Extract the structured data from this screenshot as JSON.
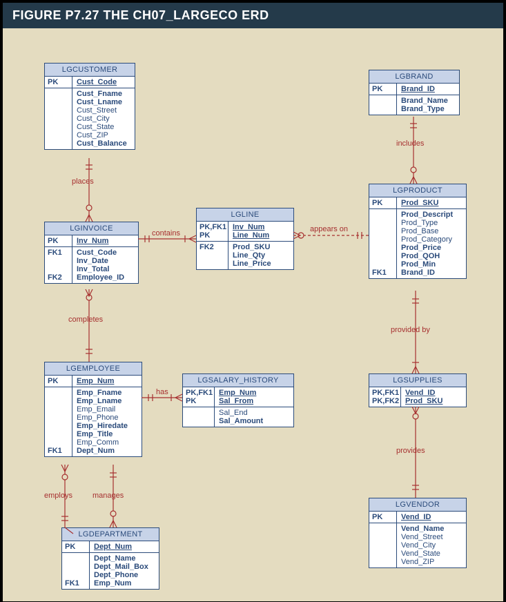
{
  "figure_title": "FIGURE P7.27  THE CH07_LARGECO ERD",
  "entities": {
    "lgcustomer": {
      "name": "LGCUSTOMER",
      "pk_key": "PK",
      "pk_attr": "Cust_Code",
      "attrs": [
        "Cust_Fname",
        "Cust_Lname",
        "Cust_Street",
        "Cust_City",
        "Cust_State",
        "Cust_ZIP",
        "Cust_Balance"
      ],
      "bold_idx": [
        0,
        1,
        6
      ]
    },
    "lginvoice": {
      "name": "LGINVOICE",
      "pk_key": "PK",
      "pk_attr": "Inv_Num",
      "rows": [
        {
          "key": "FK1",
          "attrs": [
            "Cust_Code",
            "Inv_Date",
            "Inv_Total"
          ],
          "bold": [
            0,
            1,
            2
          ]
        },
        {
          "key": "FK2",
          "attrs": [
            "Employee_ID"
          ],
          "bold": [
            0
          ]
        }
      ]
    },
    "lgline": {
      "name": "LGLINE",
      "pk_keys": [
        "PK,FK1",
        "PK"
      ],
      "pk_attrs": [
        "Inv_Num",
        "Line_Num"
      ],
      "rows": [
        {
          "key": "FK2",
          "attrs": [
            "Prod_SKU",
            "Line_Qty",
            "Line_Price"
          ],
          "bold": [
            0,
            1,
            2
          ]
        }
      ]
    },
    "lgbrand": {
      "name": "LGBRAND",
      "pk_key": "PK",
      "pk_attr": "Brand_ID",
      "attrs": [
        "Brand_Name",
        "Brand_Type"
      ],
      "bold_idx": [
        0,
        1
      ]
    },
    "lgproduct": {
      "name": "LGPRODUCT",
      "pk_key": "PK",
      "pk_attr": "Prod_SKU",
      "rows": [
        {
          "key": "",
          "attrs": [
            "Prod_Descript",
            "Prod_Type",
            "Prod_Base",
            "Prod_Category",
            "Prod_Price",
            "Prod_QOH",
            "Prod_Min"
          ],
          "bold": [
            0,
            4,
            5,
            6
          ]
        },
        {
          "key": "FK1",
          "attrs": [
            "Brand_ID"
          ],
          "bold": [
            0
          ]
        }
      ]
    },
    "lgemployee": {
      "name": "LGEMPLOYEE",
      "pk_key": "PK",
      "pk_attr": "Emp_Num",
      "rows": [
        {
          "key": "",
          "attrs": [
            "Emp_Fname",
            "Emp_Lname",
            "Emp_Email",
            "Emp_Phone",
            "Emp_Hiredate",
            "Emp_Title",
            "Emp_Comm"
          ],
          "bold": [
            0,
            1,
            4,
            5
          ]
        },
        {
          "key": "FK1",
          "attrs": [
            "Dept_Num"
          ],
          "bold": [
            0
          ]
        }
      ]
    },
    "lgsalary": {
      "name": "LGSALARY_HISTORY",
      "pk_keys": [
        "PK,FK1",
        "PK"
      ],
      "pk_attrs": [
        "Emp_Num",
        "Sal_From"
      ],
      "attrs": [
        "Sal_End",
        "Sal_Amount"
      ],
      "bold_idx": [
        1
      ]
    },
    "lgdepartment": {
      "name": "LGDEPARTMENT",
      "pk_key": "PK",
      "pk_attr": "Dept_Num",
      "rows": [
        {
          "key": "",
          "attrs": [
            "Dept_Name",
            "Dept_Mail_Box",
            "Dept_Phone"
          ],
          "bold": [
            0,
            1,
            2
          ]
        },
        {
          "key": "FK1",
          "attrs": [
            "Emp_Num"
          ],
          "bold": [
            0
          ]
        }
      ]
    },
    "lgsupplies": {
      "name": "LGSUPPLIES",
      "pk_keys": [
        "PK,FK1",
        "PK,FK2"
      ],
      "pk_attrs": [
        "Vend_ID",
        "Prod_SKU"
      ]
    },
    "lgvendor": {
      "name": "LGVENDOR",
      "pk_key": "PK",
      "pk_attr": "Vend_ID",
      "attrs": [
        "Vend_Name",
        "Vend_Street",
        "Vend_City",
        "Vend_State",
        "Vend_ZIP"
      ],
      "bold_idx": [
        0
      ]
    }
  },
  "relationships": {
    "places": "places",
    "contains": "contains",
    "appears_on": "appears on",
    "includes": "includes",
    "completes": "completes",
    "has": "has",
    "employs": "employs",
    "manages": "manages",
    "provided_by": "provided by",
    "provides": "provides"
  }
}
